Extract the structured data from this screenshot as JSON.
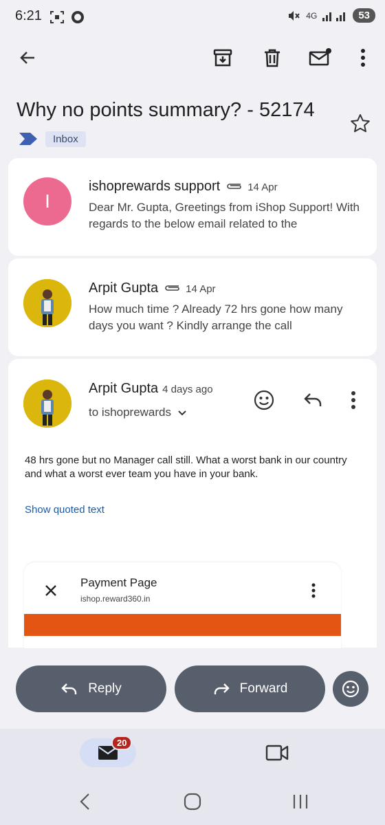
{
  "status_bar": {
    "time": "6:21",
    "network": "4G",
    "battery": "53",
    "icons": [
      "screenshot-icon",
      "record-icon",
      "mute-icon",
      "signal-icon",
      "battery-icon"
    ]
  },
  "toolbar": {
    "icons": [
      "back-arrow-icon",
      "archive-icon",
      "delete-icon",
      "mark-unread-icon",
      "more-vert-icon"
    ]
  },
  "email": {
    "subject": "Why no points summary? - 52174",
    "label": "Inbox"
  },
  "messages": [
    {
      "initial": "I",
      "avatar_color": "#ec6a8f",
      "sender": "ishoprewards support",
      "date": "14 Apr",
      "snippet": "Dear Mr. Gupta, Greetings from iShop Support! With regards to the below email related to the"
    },
    {
      "sender": "Arpit Gupta",
      "date": "14 Apr",
      "snippet": "How much time ? Already 72 hrs gone how many days you want ? Kindly arrange the call"
    },
    {
      "sender": "Arpit Gupta",
      "date": "4 days ago",
      "to": "to ishoprewards",
      "body": "48 hrs gone but no Manager call still. What a worst bank in our country and what a worst ever team you have in your bank.",
      "show_quoted": "Show quoted text"
    }
  ],
  "embedded_screenshot": {
    "title": "Payment Page",
    "url": "ishop.reward360.in",
    "accent": "#e35512"
  },
  "actions": {
    "reply": "Reply",
    "forward": "Forward"
  },
  "bottom_nav": {
    "mail_badge": "20"
  },
  "colors": {
    "button_bg": "#575f6d",
    "link": "#1a5ba8",
    "badge": "#b3261e"
  }
}
